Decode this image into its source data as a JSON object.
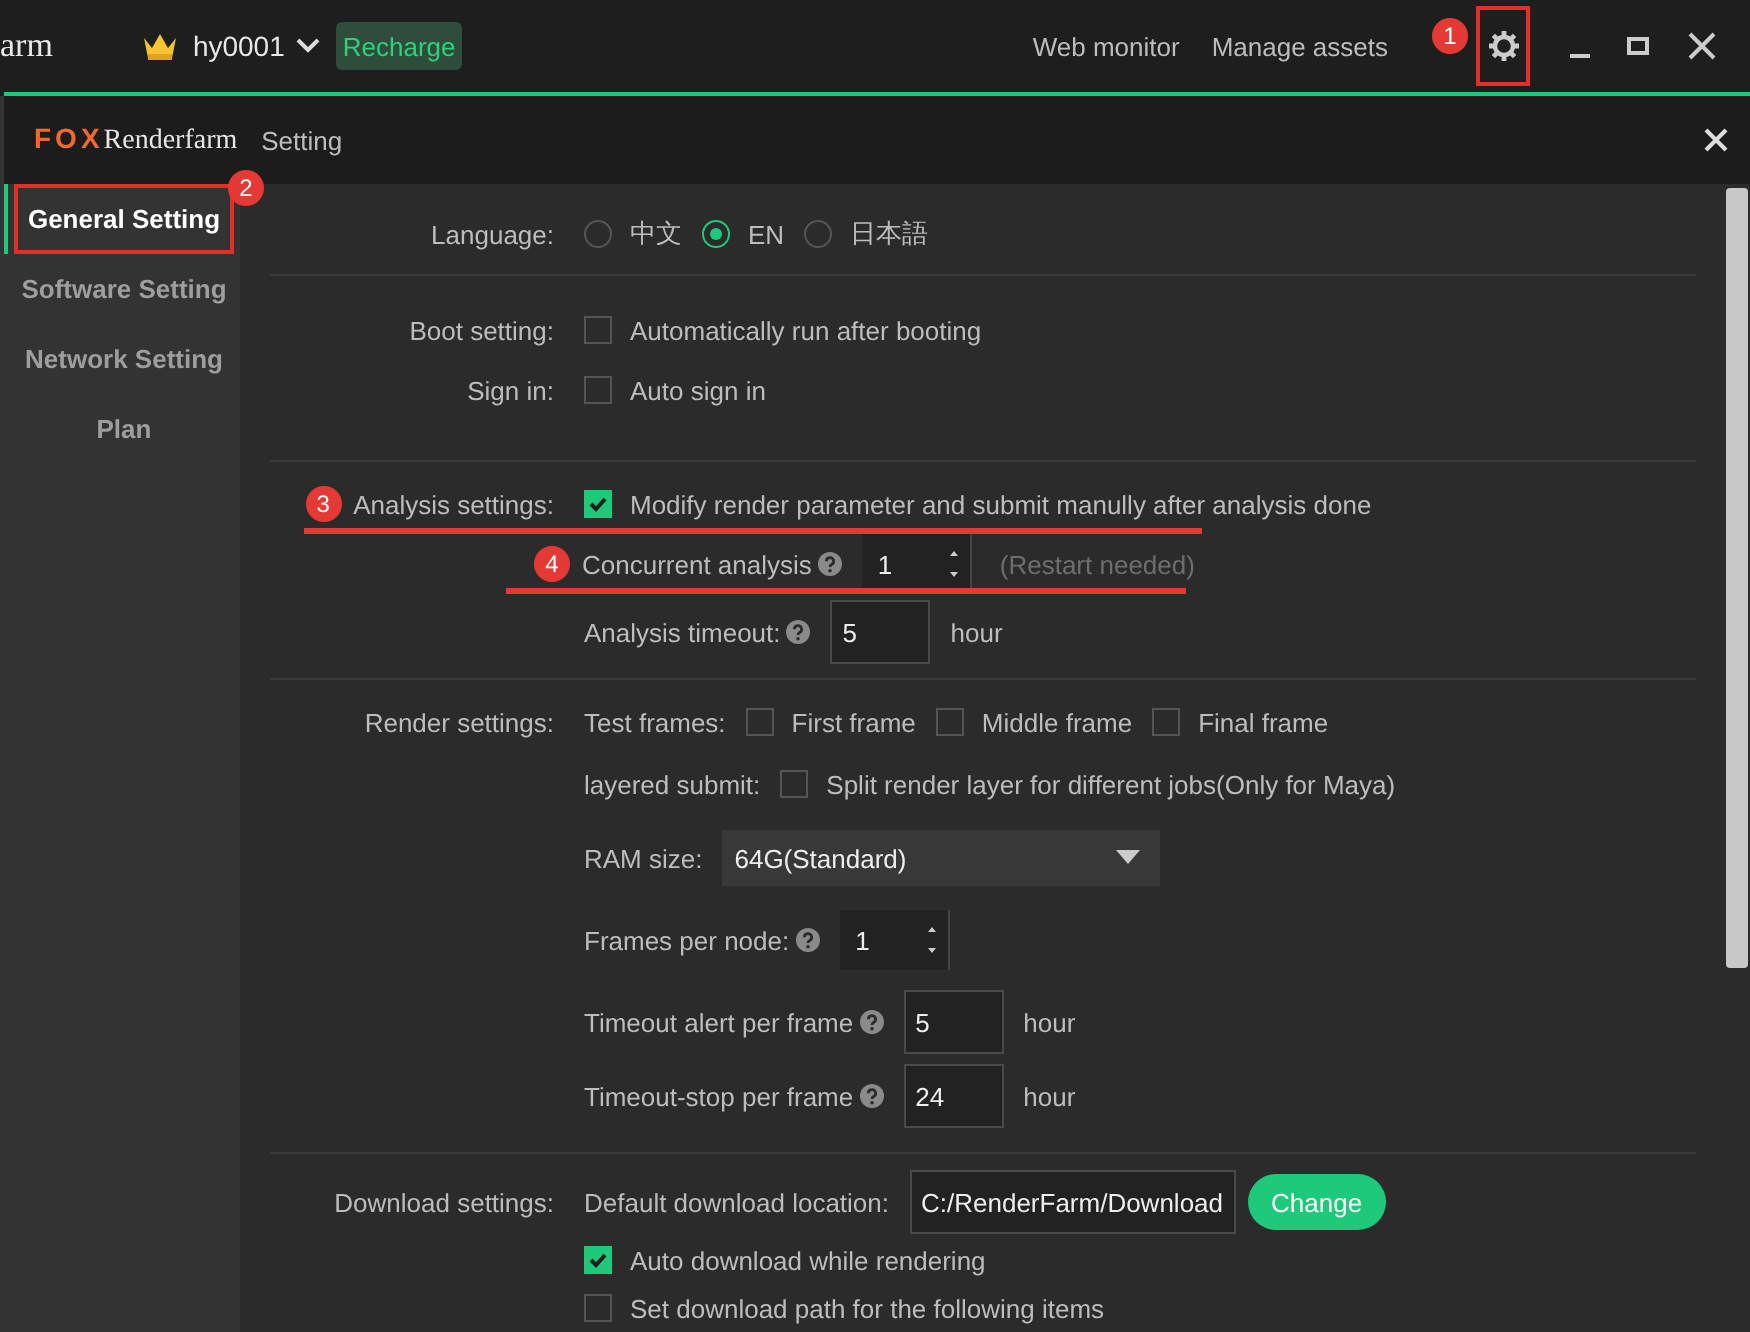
{
  "topbar": {
    "app_title": "arm",
    "user": "hy0001",
    "recharge": "Recharge",
    "links": [
      "Web monitor",
      "Manage assets"
    ],
    "annotation": {
      "label": "1",
      "kind": "box"
    }
  },
  "dialog": {
    "logo_brand": "FOX",
    "logo_rest": "Renderfarm",
    "title": "Setting"
  },
  "sidebar": {
    "items": [
      {
        "label": "General Setting",
        "selected": true,
        "annotation": {
          "label": "2",
          "kind": "box"
        }
      },
      {
        "label": "Software Setting",
        "selected": false
      },
      {
        "label": "Network Setting",
        "selected": false
      },
      {
        "label": "Plan",
        "selected": false
      }
    ]
  },
  "sections": [
    {
      "rows": [
        {
          "label": "Language:",
          "controls": [
            {
              "kind": "radio",
              "label": "中文",
              "selected": false
            },
            {
              "kind": "radio",
              "label": "EN",
              "selected": true
            },
            {
              "kind": "radio",
              "label": "日本語",
              "selected": false
            }
          ]
        }
      ]
    },
    {
      "rows": [
        {
          "label": "Boot setting:",
          "controls": [
            {
              "kind": "checkbox",
              "label": "Automatically run after booting",
              "checked": false
            }
          ]
        },
        {
          "label": "Sign in:",
          "controls": [
            {
              "kind": "checkbox",
              "label": "Auto sign in",
              "checked": false
            }
          ]
        }
      ]
    },
    {
      "rows": [
        {
          "label": "Analysis settings:",
          "annotation": {
            "label": "3",
            "kind": "underline"
          },
          "controls": [
            {
              "kind": "checkbox",
              "label": "Modify render parameter and submit manully after analysis done",
              "checked": true
            }
          ]
        },
        {
          "annotation": {
            "label": "4",
            "kind": "underline"
          },
          "controls": [
            {
              "kind": "text",
              "text": "Concurrent analysis",
              "help": true
            },
            {
              "kind": "spinner",
              "value": "1"
            },
            {
              "kind": "note",
              "text": "(Restart needed)"
            }
          ]
        },
        {
          "controls": [
            {
              "kind": "text",
              "text": "Analysis timeout:",
              "help": true
            },
            {
              "kind": "input",
              "value": "5"
            },
            {
              "kind": "text",
              "text": "hour"
            }
          ]
        }
      ]
    },
    {
      "rows": [
        {
          "label": "Render settings:",
          "controls": [
            {
              "kind": "text",
              "text": "Test frames:"
            },
            {
              "kind": "checkbox",
              "label": "First frame",
              "checked": false
            },
            {
              "kind": "checkbox",
              "label": "Middle frame",
              "checked": false
            },
            {
              "kind": "checkbox",
              "label": "Final frame",
              "checked": false
            }
          ]
        },
        {
          "controls": [
            {
              "kind": "text",
              "text": "layered submit:"
            },
            {
              "kind": "checkbox",
              "label": "Split render layer for different jobs(Only for Maya)",
              "checked": false
            }
          ]
        },
        {
          "controls": [
            {
              "kind": "text",
              "text": "RAM size:"
            },
            {
              "kind": "dropdown",
              "value": "64G(Standard)"
            }
          ]
        },
        {
          "controls": [
            {
              "kind": "text",
              "text": "Frames per node:",
              "help": true
            },
            {
              "kind": "spinner",
              "value": "1"
            }
          ]
        },
        {
          "controls": [
            {
              "kind": "text",
              "text": "Timeout alert per frame",
              "help": true
            },
            {
              "kind": "input",
              "value": "5"
            },
            {
              "kind": "text",
              "text": "hour"
            }
          ]
        },
        {
          "controls": [
            {
              "kind": "text",
              "text": "Timeout-stop per frame",
              "help": true
            },
            {
              "kind": "input",
              "value": "24"
            },
            {
              "kind": "text",
              "text": "hour"
            }
          ]
        }
      ]
    },
    {
      "rows": [
        {
          "label": "Download settings:",
          "controls": [
            {
              "kind": "text",
              "text": "Default download location:"
            },
            {
              "kind": "input",
              "value": "C:/RenderFarm/Download",
              "wide": true
            },
            {
              "kind": "button",
              "text": "Change"
            }
          ]
        },
        {
          "controls": [
            {
              "kind": "checkbox",
              "label": "Auto download while rendering",
              "checked": true
            }
          ]
        },
        {
          "controls": [
            {
              "kind": "checkbox",
              "label": "Set download path for the following items",
              "checked": false
            }
          ]
        }
      ]
    }
  ]
}
